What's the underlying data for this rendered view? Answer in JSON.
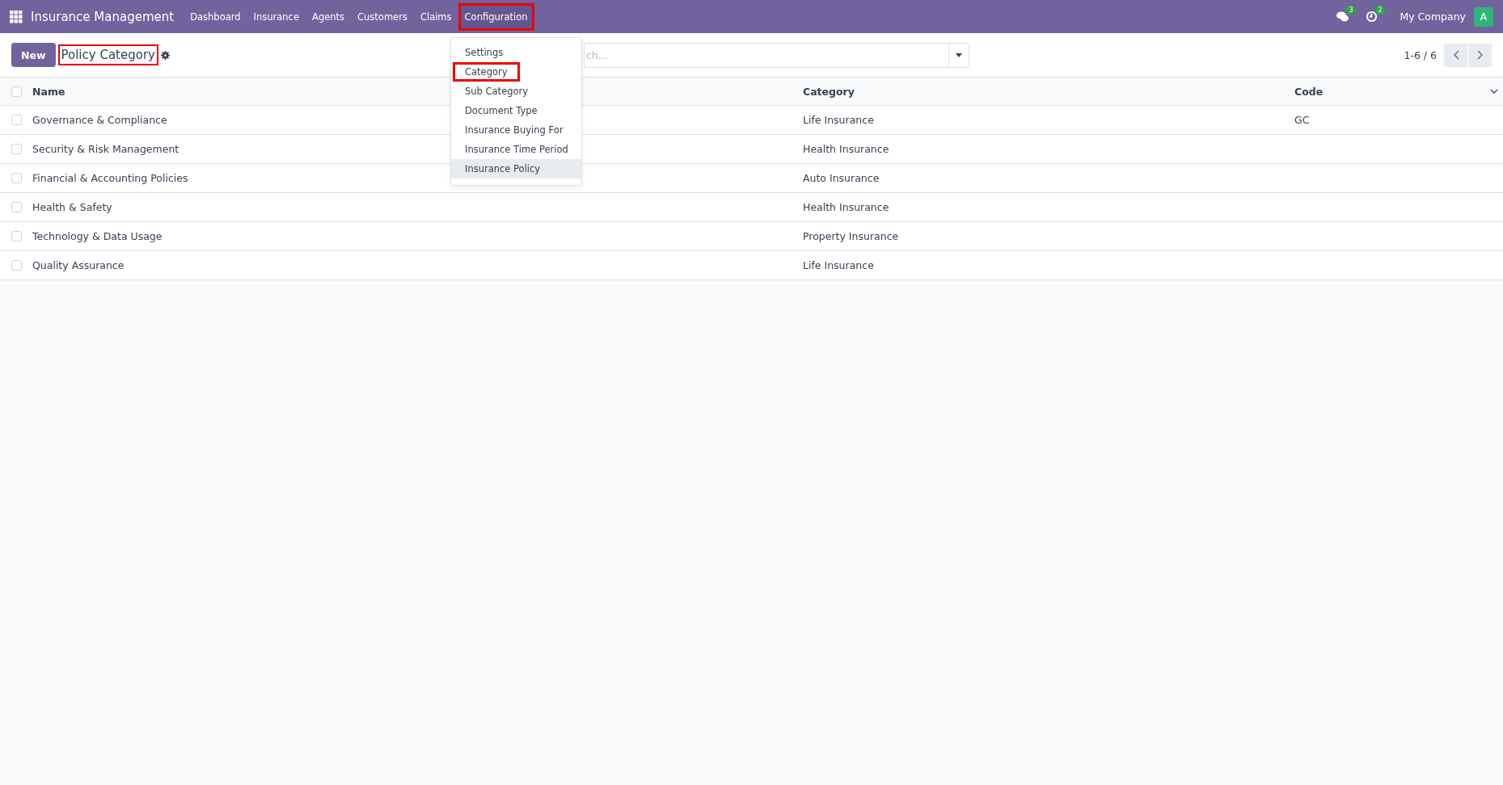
{
  "navbar": {
    "app_name": "Insurance Management",
    "menu": [
      {
        "label": "Dashboard",
        "highlighted": false
      },
      {
        "label": "Insurance",
        "highlighted": false
      },
      {
        "label": "Agents",
        "highlighted": false
      },
      {
        "label": "Customers",
        "highlighted": false
      },
      {
        "label": "Claims",
        "highlighted": false
      },
      {
        "label": "Configuration",
        "highlighted": true
      }
    ],
    "messages_badge": "3",
    "activities_badge": "2",
    "company": "My Company",
    "avatar": "A"
  },
  "control_panel": {
    "new_button": "New",
    "title": "Policy Category",
    "title_highlighted": true,
    "search": {
      "placeholder": "ch..."
    },
    "pager": "1-6 / 6"
  },
  "dropdown": {
    "items": [
      {
        "label": "Settings",
        "highlighted": false,
        "hovered": false
      },
      {
        "label": "Category",
        "highlighted": true,
        "hovered": false
      },
      {
        "label": "Sub Category",
        "highlighted": false,
        "hovered": false
      },
      {
        "label": "Document Type",
        "highlighted": false,
        "hovered": false
      },
      {
        "label": "Insurance Buying For",
        "highlighted": false,
        "hovered": false
      },
      {
        "label": "Insurance Time Period",
        "highlighted": false,
        "hovered": false
      },
      {
        "label": "Insurance Policy",
        "highlighted": false,
        "hovered": true
      }
    ]
  },
  "table": {
    "all_checked": false,
    "columns": [
      "Name",
      "Category",
      "Code"
    ],
    "rows": [
      {
        "checked": false,
        "cells": [
          "Governance & Compliance",
          "Life Insurance",
          "GC"
        ]
      },
      {
        "checked": false,
        "cells": [
          "Security & Risk Management",
          "Health Insurance",
          ""
        ]
      },
      {
        "checked": false,
        "cells": [
          "Financial & Accounting Policies",
          "Auto Insurance",
          ""
        ]
      },
      {
        "checked": false,
        "cells": [
          "Health & Safety",
          "Health Insurance",
          ""
        ]
      },
      {
        "checked": false,
        "cells": [
          "Technology & Data Usage",
          "Property Insurance",
          ""
        ]
      },
      {
        "checked": false,
        "cells": [
          "Quality Assurance",
          "Life Insurance",
          ""
        ]
      }
    ]
  }
}
